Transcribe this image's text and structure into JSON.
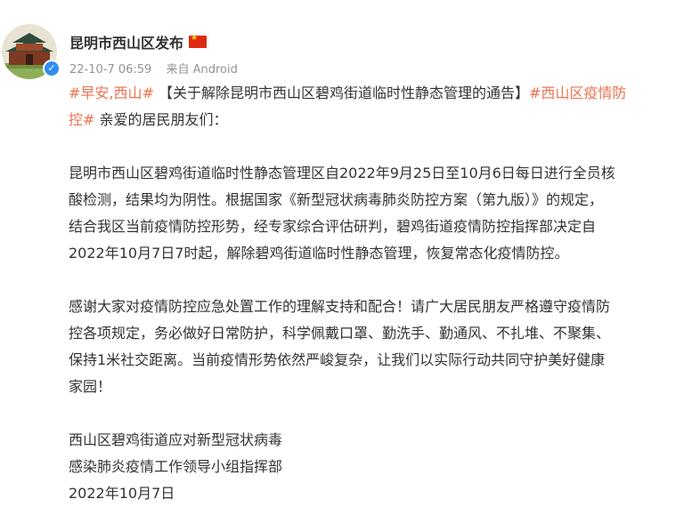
{
  "account": {
    "name": "昆明市西山区发布",
    "time": "22-10-7 06:59",
    "source": "来自 Android"
  },
  "post": {
    "tag1": "#早安,西山#",
    "title": " 【关于解除昆明市西山区碧鸡街道临时性静态管理的通告】",
    "tag2_line1": "#西山区疫情防",
    "tag2_line2": "控#",
    "greeting": " 亲爱的居民朋友们：",
    "para1": [
      "昆明市西山区碧鸡街道临时性静态管理区自2022年9月25日至10月6日每日进行全员核",
      "酸检测，结果均为阴性。根据国家《新型冠状病毒肺炎防控方案（第九版）》的规定，",
      "结合我区当前疫情防控形势，经专家综合评估研判，碧鸡街道疫情防控指挥部决定自",
      "2022年10月7日7时起，解除碧鸡街道临时性静态管理，恢复常态化疫情防控。"
    ],
    "para2": [
      "感谢大家对疫情防控应急处置工作的理解支持和配合！请广大居民朋友严格遵守疫情防",
      "控各项规定，务必做好日常防护，科学佩戴口罩、勤洗手、勤通风、不扎堆、不聚集、",
      "保持1米社交距离。当前疫情形势依然严峻复杂，让我们以实际行动共同守护美好健康",
      "家园！"
    ],
    "signature": [
      "西山区碧鸡街道应对新型冠状病毒",
      "感染肺炎疫情工作领导小组指挥部",
      "2022年10月7日"
    ]
  },
  "colors": {
    "tag": "#eb7350",
    "text": "#333333",
    "meta": "#939393",
    "verified": "#2f8cf0"
  },
  "icons": {
    "verified": "verified-icon",
    "flag": "china-flag-icon",
    "avatar": "avatar-pavilion"
  }
}
